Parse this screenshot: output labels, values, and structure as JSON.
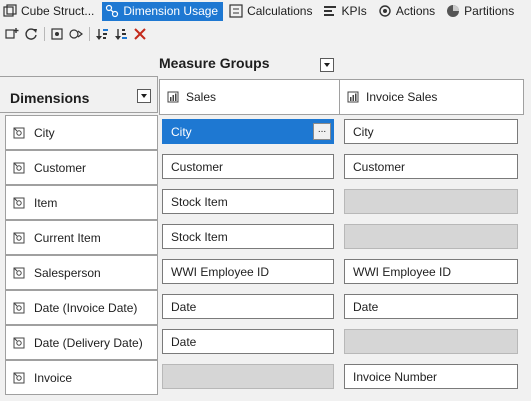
{
  "tabs": [
    {
      "label": "Cube Struct...",
      "icon": "cube-structure-icon",
      "active": false
    },
    {
      "label": "Dimension Usage",
      "icon": "dimension-usage-icon",
      "active": true
    },
    {
      "label": "Calculations",
      "icon": "calculations-icon",
      "active": false
    },
    {
      "label": "KPIs",
      "icon": "kpis-icon",
      "active": false
    },
    {
      "label": "Actions",
      "icon": "actions-icon",
      "active": false
    },
    {
      "label": "Partitions",
      "icon": "partitions-icon",
      "active": false
    }
  ],
  "grid": {
    "measure_groups_header": "Measure Groups",
    "dimensions_header": "Dimensions",
    "measure_groups": [
      {
        "name": "Sales"
      },
      {
        "name": "Invoice Sales"
      }
    ],
    "rows": [
      {
        "dimension": "City",
        "cells": [
          "City",
          "City"
        ]
      },
      {
        "dimension": "Customer",
        "cells": [
          "Customer",
          "Customer"
        ]
      },
      {
        "dimension": "Item",
        "cells": [
          "Stock Item",
          ""
        ]
      },
      {
        "dimension": "Current Item",
        "cells": [
          "Stock Item",
          ""
        ]
      },
      {
        "dimension": "Salesperson",
        "cells": [
          "WWI Employee ID",
          "WWI Employee ID"
        ]
      },
      {
        "dimension": "Date (Invoice Date)",
        "cells": [
          "Date",
          "Date"
        ]
      },
      {
        "dimension": "Date (Delivery Date)",
        "cells": [
          "Date",
          ""
        ]
      },
      {
        "dimension": "Invoice",
        "cells": [
          "",
          "Invoice Number"
        ]
      }
    ],
    "selected_cell_ellipsis": "..."
  },
  "colors": {
    "accent": "#1e78d2",
    "empty_cell": "#d6d6d6",
    "delete_icon": "#c42b1c"
  }
}
